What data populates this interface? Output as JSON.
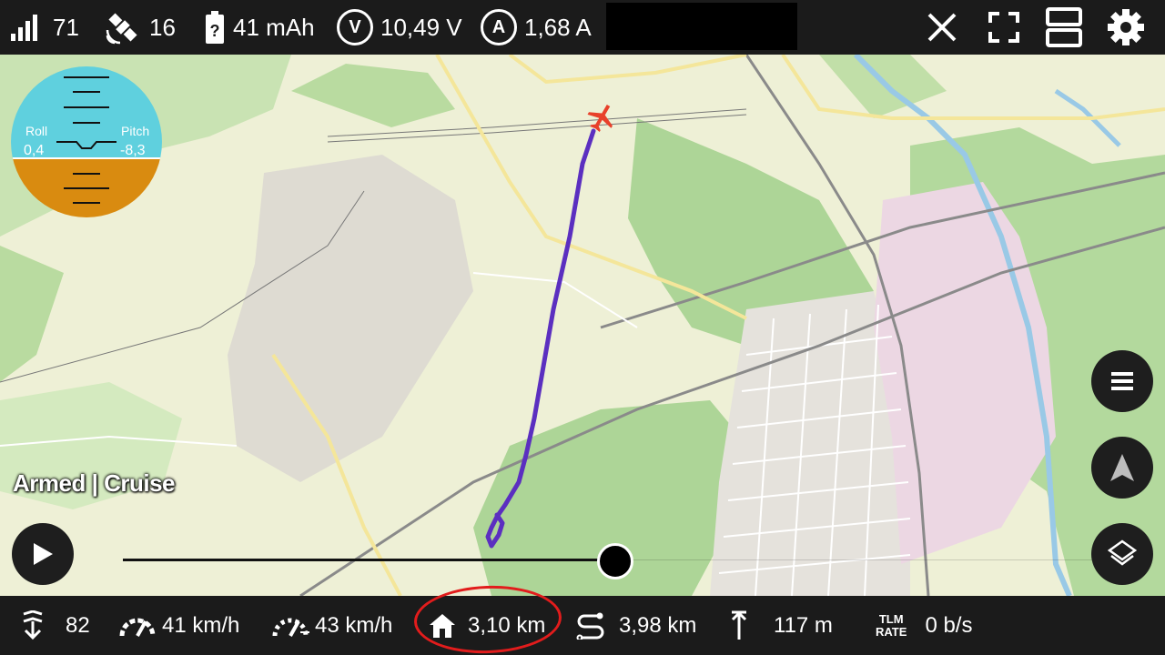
{
  "topbar": {
    "signal": "71",
    "satellites": "16",
    "battery": "41 mAh",
    "voltage_badge": "V",
    "voltage": "10,49 V",
    "current_badge": "A",
    "current": "1,68 A"
  },
  "horizon": {
    "roll_label": "Roll",
    "roll_value": "0,4",
    "pitch_label": "Pitch",
    "pitch_value": "-8,3"
  },
  "status": {
    "mode": "Armed | Cruise"
  },
  "bottombar": {
    "throttle": "82",
    "ground_speed": "41 km/h",
    "air_speed": "43 km/h",
    "home_distance": "3,10 km",
    "trip_distance": "3,98 km",
    "altitude": "117 m",
    "tlm_line1": "TLM",
    "tlm_line2": "RATE",
    "tlm_rate": "0 b/s"
  },
  "colors": {
    "bar_background": "#1b1b1b",
    "track_color": "#5b2fc0",
    "aircraft_color": "#e8402a",
    "highlight_circle": "#e21c1c",
    "sky": "#5fd0de",
    "ground": "#d98b10"
  },
  "icons": [
    "signal-icon",
    "satellite-icon",
    "battery-icon",
    "close-icon",
    "fullscreen-icon",
    "layout-icon",
    "gear-icon",
    "play-icon",
    "menu-icon",
    "navigation-icon",
    "layers-icon",
    "throttle-icon",
    "ground-speed-icon",
    "air-speed-icon",
    "home-icon",
    "trip-icon",
    "altitude-icon"
  ]
}
